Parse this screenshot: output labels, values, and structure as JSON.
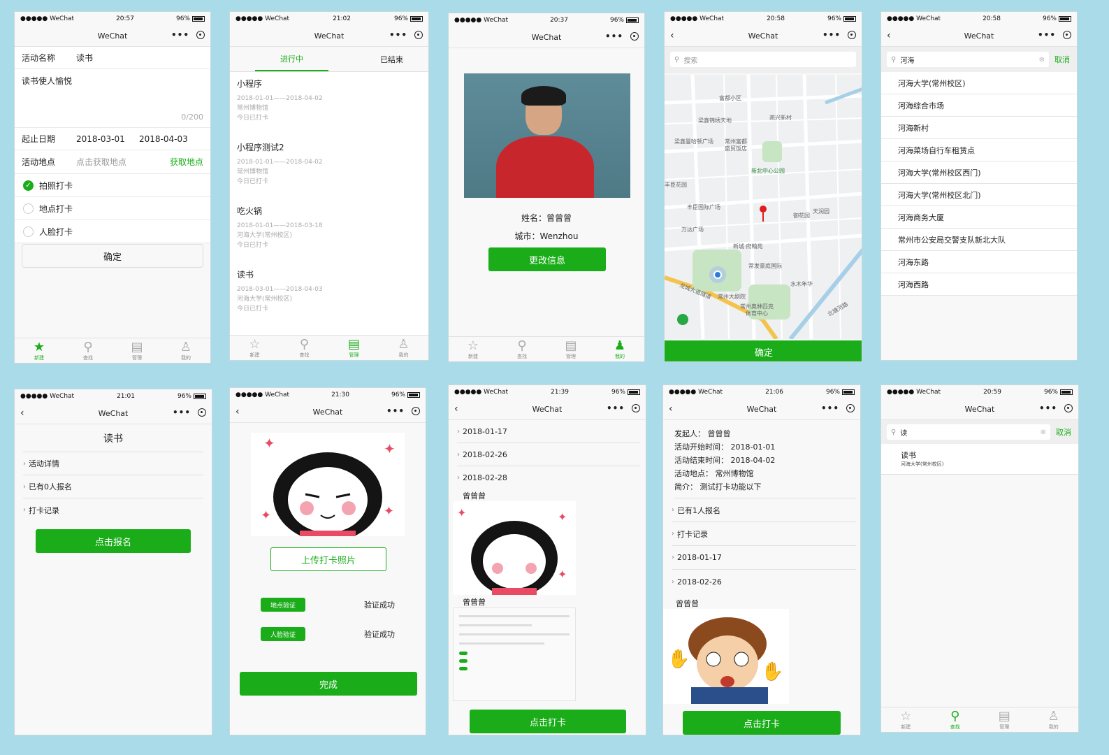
{
  "common": {
    "carrier": "●●●●● WeChat",
    "battery": "96%",
    "nav_title": "WeChat"
  },
  "tabs": {
    "new": "新建",
    "find": "查找",
    "manage": "管理",
    "mine": "我的"
  },
  "p1": {
    "time": "20:57",
    "name_label": "活动名称",
    "name_value": "读书",
    "desc": "读书使人愉悦",
    "counter": "0/200",
    "date_label": "起止日期",
    "date_start": "2018-03-01",
    "date_end": "2018-04-03",
    "place_label": "活动地点",
    "place_placeholder": "点击获取地点",
    "place_btn": "获取地点",
    "opt1": "拍照打卡",
    "opt2": "地点打卡",
    "opt3": "人脸打卡",
    "confirm": "确定"
  },
  "p2": {
    "time": "21:02",
    "tab_active": "进行中",
    "tab_ended": "已结束",
    "items": [
      {
        "title": "小程序",
        "dates": "2018-01-01——2018-04-02",
        "place": "常州博物馆",
        "status": "今日已打卡"
      },
      {
        "title": "小程序测试2",
        "dates": "2018-01-01——2018-04-02",
        "place": "常州博物馆",
        "status": "今日已打卡"
      },
      {
        "title": "吃火锅",
        "dates": "2018-01-01——2018-03-18",
        "place": "河海大学(常州校区)",
        "status": "今日已打卡"
      },
      {
        "title": "读书",
        "dates": "2018-03-01——2018-04-03",
        "place": "河海大学(常州校区)",
        "status": "今日已打卡"
      }
    ]
  },
  "p3": {
    "time": "20:37",
    "name_line": "姓名：曾曾曾",
    "city_line": "城市：Wenzhou",
    "btn": "更改信息"
  },
  "p4": {
    "time": "20:58",
    "search_placeholder": "搜索",
    "confirm": "确定",
    "map_labels": [
      "富都小区",
      "梁鑫锦绣天地",
      "燕兴新村",
      "梁鑫曼哈顿广场",
      "常州富都",
      "盛贸饭店",
      "新北中心公园",
      "丰臣花园",
      "丰臣国际广场",
      "御花园",
      "天润园",
      "万达广场",
      "新城·府翰苑",
      "常发豪庭国际",
      "水木年华",
      "龙城大道隧道",
      "常州大剧院",
      "常州奥林匹克",
      "体育中心",
      "北塘河路"
    ]
  },
  "p5": {
    "time": "20:58",
    "query": "河海",
    "cancel": "取消",
    "results": [
      "河海大学(常州校区)",
      "河海综合市场",
      "河海新村",
      "河海菜场自行车租赁点",
      "河海大学(常州校区西门)",
      "河海大学(常州校区北门)",
      "河海商务大厦",
      "常州市公安局交警支队新北大队",
      "河海东路",
      "河海西路"
    ]
  },
  "p6": {
    "time": "21:01",
    "title": "读书",
    "row1": "活动详情",
    "row2": "已有0人报名",
    "row3": "打卡记录",
    "btn": "点击报名"
  },
  "p7": {
    "time": "21:30",
    "upload": "上传打卡照片",
    "loc_badge": "地点验证",
    "loc_status": "验证成功",
    "face_badge": "人脸验证",
    "face_status": "验证成功",
    "done": "完成"
  },
  "p8": {
    "time": "21:39",
    "date1": "2018-01-17",
    "date2": "2018-02-26",
    "date3": "2018-02-28",
    "user1": "曾曾曾",
    "user2": "曾曾曾",
    "btn": "点击打卡"
  },
  "p9": {
    "time": "21:06",
    "l1": "发起人：  曾曾曾",
    "l2": "活动开始时间：  2018-01-01",
    "l3": "活动结束时间：  2018-04-02",
    "l4": "活动地点：  常州博物馆",
    "l5": "简介：  测试打卡功能以下",
    "row1": "已有1人报名",
    "row2": "打卡记录",
    "row3": "2018-01-17",
    "row4": "2018-02-26",
    "user": "曾曾曾",
    "btn": "点击打卡"
  },
  "p10": {
    "time": "20:59",
    "query": "读",
    "cancel": "取消",
    "result_title": "读书",
    "result_sub": "河海大学(常州校区)"
  }
}
